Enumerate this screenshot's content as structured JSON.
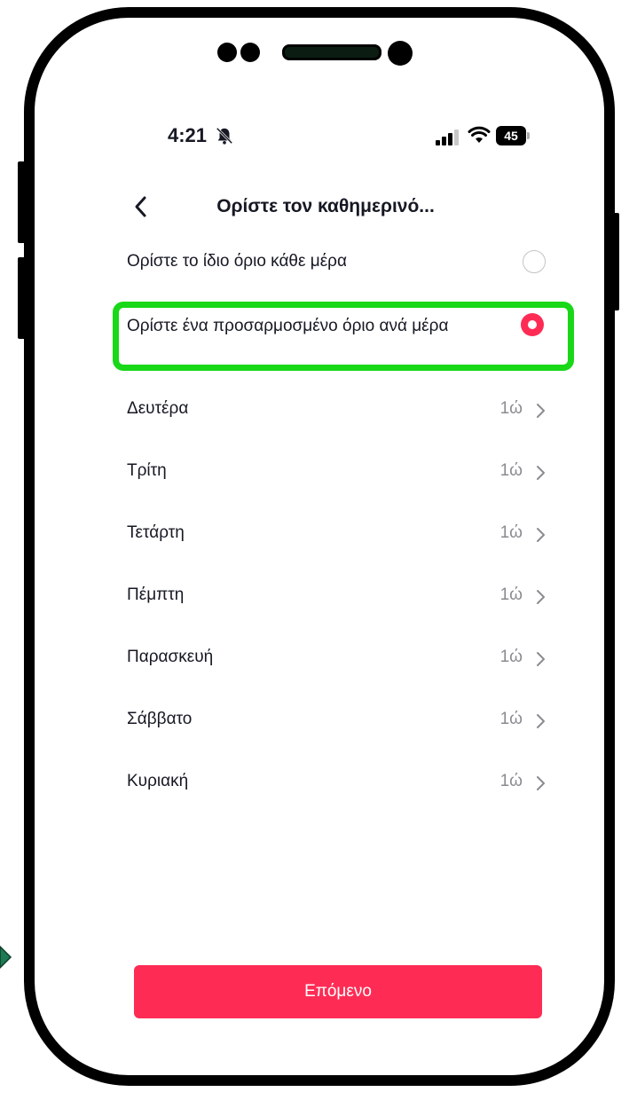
{
  "status_bar": {
    "time": "4:21",
    "battery": "45"
  },
  "header": {
    "title": "Ορίστε τον καθημερινό..."
  },
  "options": {
    "same_limit_label": "Ορίστε το ίδιο όριο κάθε μέρα",
    "custom_limit_label": "Ορίστε ένα προσαρμοσμένο όριο ανά μέρα",
    "selected": "custom"
  },
  "days": [
    {
      "label": "Δευτέρα",
      "value": "1ώ"
    },
    {
      "label": "Τρίτη",
      "value": "1ώ"
    },
    {
      "label": "Τετάρτη",
      "value": "1ώ"
    },
    {
      "label": "Πέμπτη",
      "value": "1ώ"
    },
    {
      "label": "Παρασκευή",
      "value": "1ώ"
    },
    {
      "label": "Σάββατο",
      "value": "1ώ"
    },
    {
      "label": "Κυριακή",
      "value": "1ώ"
    }
  ],
  "footer": {
    "next_label": "Επόμενο"
  },
  "colors": {
    "accent": "#fe2c55",
    "highlight": "#18d818",
    "secondary_text": "#8a8b91"
  }
}
